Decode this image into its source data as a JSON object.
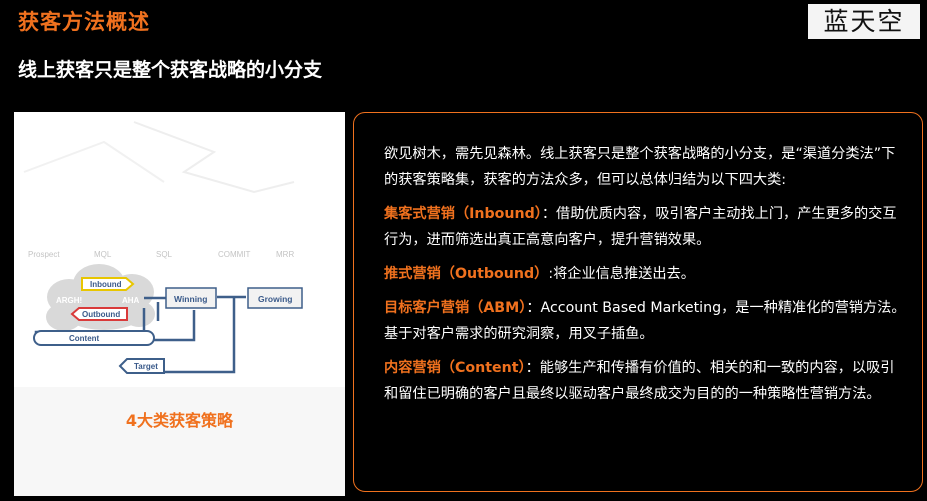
{
  "header": {
    "title": "获客方法概述",
    "subtitle": "线上获客只是整个获客战略的小分支",
    "logo": "蓝天空"
  },
  "diagram": {
    "stages": [
      "Prospect",
      "MQL",
      "SQL",
      "COMMIT",
      "MRR"
    ],
    "cloud_labels": [
      "ARGH!",
      "AHA"
    ],
    "buttons": [
      "Inbound",
      "Outbound",
      "Content",
      "Target"
    ],
    "boxes": [
      "Winning",
      "Growing"
    ],
    "caption": "4大类获客策略"
  },
  "card": {
    "intro": "欲见树木，需先见森林。线上获客只是整个获客战略的小分支，是“渠道分类法”下的获客策略集，获客的方法众多，但可以总体归结为以下四大类:",
    "items": [
      {
        "label": "集客式营销（Inbound）",
        "text": "：借助优质内容，吸引客户主动找上门，产生更多的交互行为，进而筛选出真正高意向客户，提升营销效果。"
      },
      {
        "label": "推式营销（Outbound）",
        "text": ":将企业信息推送出去。"
      },
      {
        "label": "目标客户营销（ABM）",
        "text": "：Account Based Marketing，是一种精准化的营销方法。基于对客户需求的研究洞察，用叉子插鱼。"
      },
      {
        "label": "内容营销（Content）",
        "text": "：能够生产和传播有价值的、相关的和一致的内容，以吸引和留住已明确的客户且最终以驱动客户最终成交为目的的一种策略性营销方法。"
      }
    ]
  },
  "colors": {
    "accent": "#f0711e",
    "background": "#000000",
    "text": "#ffffff"
  }
}
